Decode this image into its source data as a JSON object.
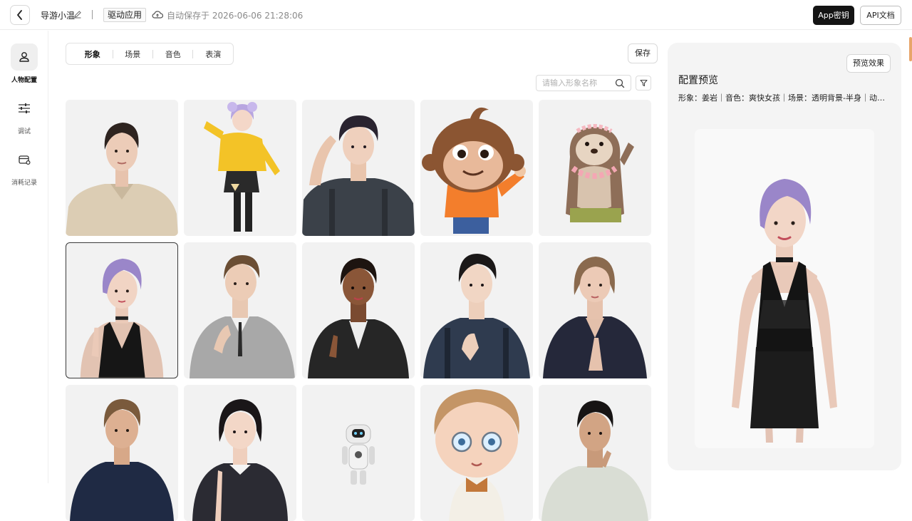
{
  "header": {
    "app_name": "导游小温",
    "mode_tag": "驱动应用",
    "autosave_text": "自动保存于 2026-06-06 21:28:06",
    "app_key_label": "App密钥",
    "api_doc_label": "API文档"
  },
  "sidebar": {
    "items": [
      {
        "label": "人物配置",
        "icon": "person-icon",
        "active": true
      },
      {
        "label": "调试",
        "icon": "sliders-icon",
        "active": false
      },
      {
        "label": "消耗记录",
        "icon": "wallet-icon",
        "active": false
      }
    ]
  },
  "main": {
    "tabs": [
      {
        "label": "形象",
        "active": true
      },
      {
        "label": "场景",
        "active": false
      },
      {
        "label": "音色",
        "active": false
      },
      {
        "label": "表演",
        "active": false
      }
    ],
    "save_label": "保存",
    "search_placeholder": "请输入形象名称"
  },
  "avatars": [
    {
      "name": "avatar-beige-sweater-woman"
    },
    {
      "name": "avatar-anime-girl-yellow-jacket"
    },
    {
      "name": "avatar-curly-hair-man-overalls"
    },
    {
      "name": "avatar-cartoon-monkey"
    },
    {
      "name": "avatar-otter-flower-lei"
    },
    {
      "name": "avatar-purple-hair-woman-selected",
      "selected": true
    },
    {
      "name": "avatar-man-grey-suit"
    },
    {
      "name": "avatar-woman-leather-jacket"
    },
    {
      "name": "avatar-man-thumbs-up"
    },
    {
      "name": "avatar-woman-navy-blazer"
    },
    {
      "name": "avatar-man-navy-shirt"
    },
    {
      "name": "avatar-woman-short-black-hair"
    },
    {
      "name": "avatar-robot"
    },
    {
      "name": "avatar-cartoon-boy-glasses"
    },
    {
      "name": "avatar-man-light-jacket"
    }
  ],
  "panel": {
    "preview_label": "预览效果",
    "title": "配置预览",
    "summary": "形象：姜岩｜音色：爽快女孩｜场景：透明背景-半身｜动作..."
  },
  "colors": {
    "primary_dark": "#141414",
    "card_bg": "#f2f2f2",
    "panel_bg": "#f4f4f4",
    "accent_purple_hair": "#9a86c9"
  }
}
